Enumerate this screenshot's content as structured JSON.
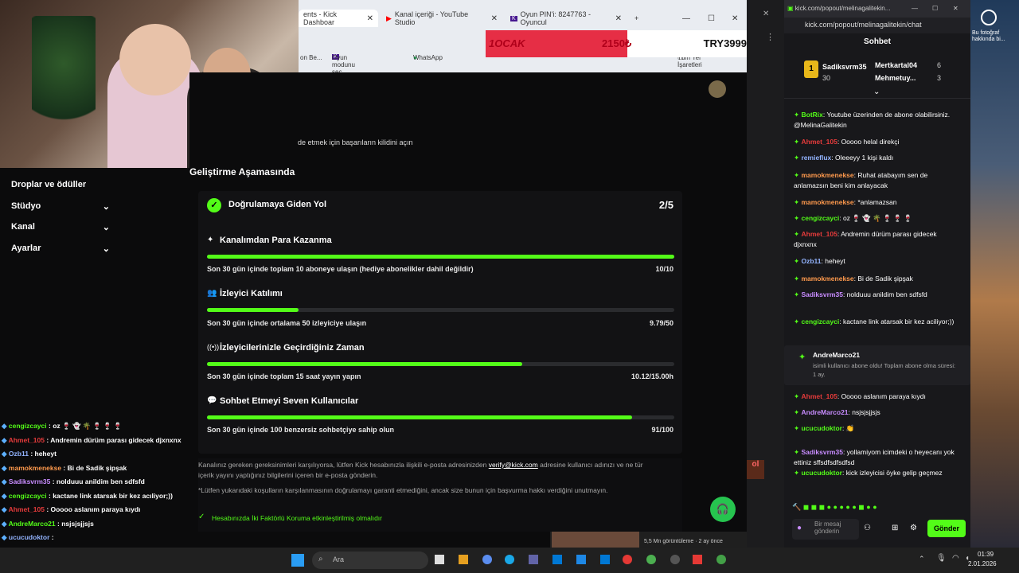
{
  "browser": {
    "tabs": [
      {
        "label": "ents - Kick Dashboar",
        "active": true
      },
      {
        "label": "Kanal içeriği - YouTube Studio"
      },
      {
        "label": "Oyun PIN'i: 8247763 - Oyuncul"
      }
    ],
    "bookmarks": [
      "on Be...",
      "Oyun modunu seç ...",
      "WhatsApp",
      "Tüm Yer İşaretleri"
    ]
  },
  "banner": {
    "date": "1OCAK",
    "amount": "2150₺",
    "price": "TRY3999"
  },
  "sidebar": {
    "items": [
      {
        "label": "Droplar ve ödüller"
      },
      {
        "label": "Stüdyo"
      },
      {
        "label": "Kanal"
      },
      {
        "label": "Ayarlar"
      }
    ]
  },
  "dashboard": {
    "unlock_text": "de etmek için başarıların kilidini açın",
    "section_title": "Geliştirme Aşamasında",
    "path_title": "Doğrulamaya Giden Yol",
    "path_progress": "2/5",
    "requirements": [
      {
        "title": "Kanalımdan Para Kazanma",
        "desc": "Son 30 gün içinde toplam 10 aboneye ulaşın (hediye abonelikler dahil değildir)",
        "value": "10/10",
        "progress": 1.0
      },
      {
        "title": "İzleyici Katılımı",
        "desc": "Son 30 gün içinde ortalama 50 izleyiciye ulaşın",
        "value": "9.79/50",
        "progress": 0.196
      },
      {
        "title": "İzleyicilerinizle Geçirdiğiniz Zaman",
        "desc": "Son 30 gün içinde toplam 15 saat yayın yapın",
        "value": "10.12/15.00h",
        "progress": 0.675
      },
      {
        "title": "Sohbet Etmeyi Seven Kullanıcılar",
        "desc": "Son 30 gün içinde 100 benzersiz sohbetçiye sahip olun",
        "value": "91/100",
        "progress": 0.91
      }
    ],
    "note_1a": "Kanalınız gereken gereksinimleri karşılıyorsa, lütfen Kick hesabınızla ilişkili e-posta adresinizden",
    "note_email": "verify@kick.com",
    "note_1b": "adresine kullanıcı adınızı ve ne tür içerik yayını yaptığınız bilgilerini içeren bir e-posta gönderin.",
    "note_2": "*Lütfen yukarıdaki koşulların karşılanmasının doğrulamayı garanti etmediğini, ancak size bunun için başvurma hakkı verdiğini unutmayın.",
    "twofa": "Hesabınızda İki Faktörlü Koruma etkinleştirilmiş olmalıdır"
  },
  "chat": {
    "url": "kick.com/popout/melinagalitekin/chat",
    "titlebar": "kick.com/popout/melinagalitekin...",
    "title": "Sohbet",
    "top": [
      {
        "name": "Sadiksvrm35",
        "count": "30"
      },
      {
        "name": "Mertkartal04",
        "count": "6"
      },
      {
        "name": "Mehmetuy...",
        "count": "3"
      }
    ],
    "messages": [
      {
        "user": "BotRix",
        "color": "#53fc18",
        "text": ": Youtube üzerinden de abone olabilirsiniz. @MelinaGalitekin"
      },
      {
        "user": "Ahmet_105",
        "color": "#e63b3b",
        "text": ": Ooooo helal direkçi"
      },
      {
        "user": "remieflux",
        "color": "#93b4ff",
        "text": ": Oleeeyy 1 kişi kaldı"
      },
      {
        "user": "mamokmenekse",
        "color": "#ff9a4d",
        "text": ": Ruhat atabayım sen de anlamazsın beni kim anlayacak"
      },
      {
        "user": "mamokmenekse",
        "color": "#ff9a4d",
        "text": ": *anlamazsan"
      },
      {
        "user": "cengizcayci",
        "color": "#53fc18",
        "text": ": oz 🍷 👻 🌴 🍷 🍷 🍷"
      },
      {
        "user": "Ahmet_105",
        "color": "#e63b3b",
        "text": ": Andremin dürüm parası gidecek djxnxnx"
      },
      {
        "user": "Ozb11",
        "color": "#93b4ff",
        "text": ": heheyt"
      },
      {
        "user": "mamokmenekse",
        "color": "#ff9a4d",
        "text": ": Bi de Sadik şipşak"
      },
      {
        "user": "Sadiksvrm35",
        "color": "#c88cff",
        "text": ": nolduuu anildim ben sdfsfd"
      },
      {
        "user": "cengizcayci",
        "color": "#53fc18",
        "text": ": kactane link atarsak bir kez aciliyor;))"
      },
      {
        "user": "Ahmet_105",
        "color": "#e63b3b",
        "text": ": Ooooo aslanım paraya kıydı"
      },
      {
        "user": "AndreMarco21",
        "color": "#c88cff",
        "text": ": nsjsjsjjsjs"
      },
      {
        "user": "ucucudoktor",
        "color": "#53fc18",
        "text": ": 👏"
      },
      {
        "user": "Sadiksvrm35",
        "color": "#c88cff",
        "text": ": yollamiyom icimdeki o heyecanı yok ettiniz sffsdfsdfsdfsd"
      },
      {
        "user": "ucucudoktor",
        "color": "#53fc18",
        "text": ": kick izleyicisi öyke gelip geçmez"
      }
    ],
    "sub_user": "AndreMarco21",
    "sub_text": "isimli kullanıcı abone oldu! Toplam abone olma süresi: 1 ay.",
    "input_placeholder": "Bir mesaj gönderin",
    "send_label": "Gönder"
  },
  "overlay_chat": [
    {
      "user": "cengizcayci",
      "color": "#53fc18",
      "text": " : oz 🍷 👻 🌴 🍷 🍷 🍷"
    },
    {
      "user": "Ahmet_105",
      "color": "#e63b3b",
      "text": " : Andremin dürüm parası gidecek djxnxnx"
    },
    {
      "user": "Ozb11",
      "color": "#93b4ff",
      "text": " : heheyt"
    },
    {
      "user": "mamokmenekse",
      "color": "#ff9a4d",
      "text": " : Bi de Sadik şipşak"
    },
    {
      "user": "Sadiksvrm35",
      "color": "#c88cff",
      "text": " : nolduuu anildim ben sdfsfd"
    },
    {
      "user": "cengizcayci",
      "color": "#53fc18",
      "text": " : kactane link atarsak bir kez acıliyor;))"
    },
    {
      "user": "Ahmet_105",
      "color": "#e63b3b",
      "text": " : Ooooo aslanım paraya kıydı"
    },
    {
      "user": "AndreMarco21",
      "color": "#53fc18",
      "text": " : nsjsjsjjsjs"
    },
    {
      "user": "ucucudoktor",
      "color": "#93b4ff",
      "text": " :"
    }
  ],
  "desktop": {
    "icon_label": "Bu fotoğraf hakkında bi..."
  },
  "youtube_popup": {
    "line1": "5,5 Mn görüntüleme · 2 ay önce"
  },
  "taskbar": {
    "search": "Ara",
    "time": "01:39",
    "date": "2.01.2026"
  },
  "colors": {
    "kick_green": "#53fc18",
    "bg": "#0b0b0c",
    "card": "#121214"
  }
}
